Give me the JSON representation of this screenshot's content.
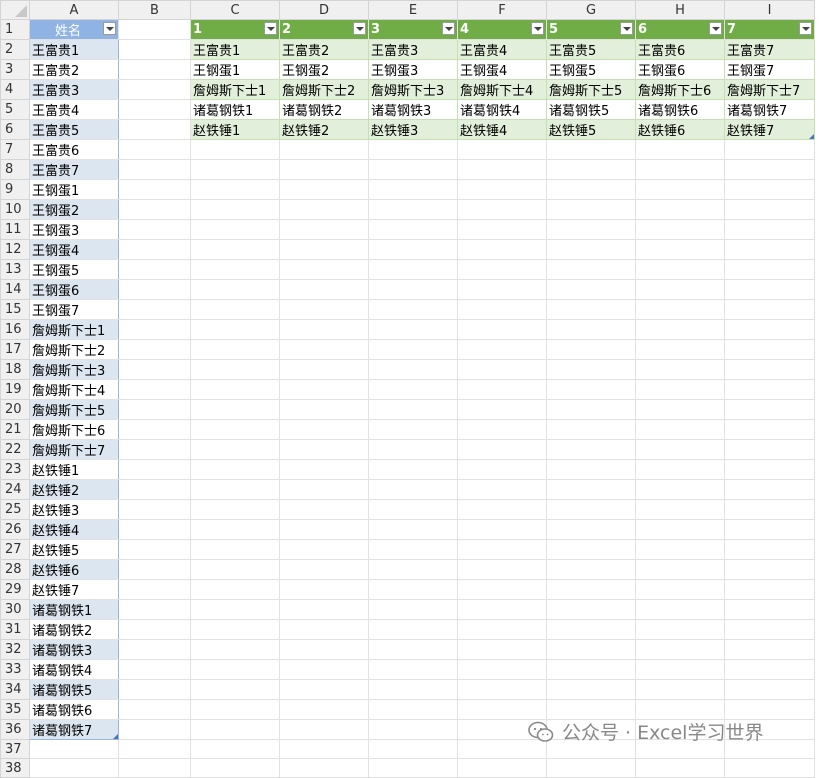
{
  "columns": [
    "A",
    "B",
    "C",
    "D",
    "E",
    "F",
    "G",
    "H",
    "I"
  ],
  "table_a": {
    "header": "姓名",
    "values": [
      "王富贵1",
      "王富贵2",
      "王富贵3",
      "王富贵4",
      "王富贵5",
      "王富贵6",
      "王富贵7",
      "王钢蛋1",
      "王钢蛋2",
      "王钢蛋3",
      "王钢蛋4",
      "王钢蛋5",
      "王钢蛋6",
      "王钢蛋7",
      "詹姆斯下士1",
      "詹姆斯下士2",
      "詹姆斯下士3",
      "詹姆斯下士4",
      "詹姆斯下士5",
      "詹姆斯下士6",
      "詹姆斯下士7",
      "赵铁锤1",
      "赵铁锤2",
      "赵铁锤3",
      "赵铁锤4",
      "赵铁锤5",
      "赵铁锤6",
      "赵铁锤7",
      "诸葛钢铁1",
      "诸葛钢铁2",
      "诸葛钢铁3",
      "诸葛钢铁4",
      "诸葛钢铁5",
      "诸葛钢铁6",
      "诸葛钢铁7"
    ]
  },
  "table_g": {
    "headers": [
      "1",
      "2",
      "3",
      "4",
      "5",
      "6",
      "7"
    ],
    "rows": [
      [
        "王富贵1",
        "王富贵2",
        "王富贵3",
        "王富贵4",
        "王富贵5",
        "王富贵6",
        "王富贵7"
      ],
      [
        "王钢蛋1",
        "王钢蛋2",
        "王钢蛋3",
        "王钢蛋4",
        "王钢蛋5",
        "王钢蛋6",
        "王钢蛋7"
      ],
      [
        "詹姆斯下士1",
        "詹姆斯下士2",
        "詹姆斯下士3",
        "詹姆斯下士4",
        "詹姆斯下士5",
        "詹姆斯下士6",
        "詹姆斯下士7"
      ],
      [
        "诸葛钢铁1",
        "诸葛钢铁2",
        "诸葛钢铁3",
        "诸葛钢铁4",
        "诸葛钢铁5",
        "诸葛钢铁6",
        "诸葛钢铁7"
      ],
      [
        "赵铁锤1",
        "赵铁锤2",
        "赵铁锤3",
        "赵铁锤4",
        "赵铁锤5",
        "赵铁锤6",
        "赵铁锤7"
      ]
    ]
  },
  "watermark": {
    "text": "公众号 · Excel学习世界",
    "icon": "wechat-icon"
  },
  "colors": {
    "blue_header": "#8fb4e3",
    "blue_band": "#dce6f1",
    "green_header": "#70ad47",
    "green_band": "#e2efda"
  }
}
